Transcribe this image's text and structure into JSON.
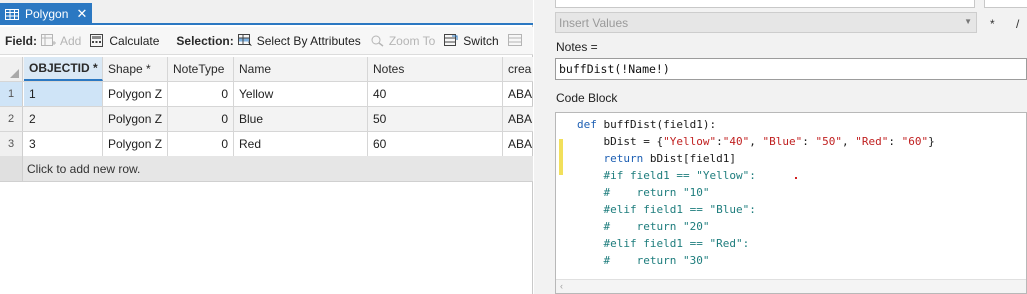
{
  "tab": {
    "title": "Polygon",
    "close": "✕"
  },
  "toolbar": {
    "field_label": "Field:",
    "add_label": "Add",
    "calculate_label": "Calculate",
    "selection_label": "Selection:",
    "select_by_attributes_label": "Select By Attributes",
    "zoom_to_label": "Zoom To",
    "switch_label": "Switch"
  },
  "table": {
    "columns": [
      "OBJECTID *",
      "Shape *",
      "NoteType",
      "Name",
      "Notes",
      "crea"
    ],
    "rows": [
      {
        "rownum": "1",
        "objectid": "1",
        "shape": "Polygon Z",
        "notetype": "0",
        "name": "Yellow",
        "notes": "40",
        "crea": "ABA"
      },
      {
        "rownum": "2",
        "objectid": "2",
        "shape": "Polygon Z",
        "notetype": "0",
        "name": "Blue",
        "notes": "50",
        "crea": "ABA"
      },
      {
        "rownum": "3",
        "objectid": "3",
        "shape": "Polygon Z",
        "notetype": "0",
        "name": "Red",
        "notes": "60",
        "crea": "ABA"
      }
    ],
    "add_row_text": "Click to add new row."
  },
  "calculator": {
    "insert_values_placeholder": "Insert Values",
    "op_multiply": "*",
    "op_divide": "/",
    "expression_label": "Notes =",
    "expression": "buffDist(!Name!)",
    "code_block_label": "Code Block",
    "code_lines": [
      "def buffDist(field1):",
      "    bDist = {\"Yellow\":\"40\", \"Blue\": \"50\", \"Red\": \"60\"}",
      "    return bDist[field1]",
      "    #if field1 == \"Yellow\":",
      "    #    return \"10\"",
      "    #elif field1 == \"Blue\":",
      "    #    return \"20\"",
      "    #elif field1 == \"Red\":",
      "    #    return \"30\""
    ]
  },
  "colors": {
    "accent": "#2b78c2",
    "selected_row": "#cfe4f7",
    "keyword": "#1d5fb3",
    "string": "#c02020",
    "comment": "#1e7d7d",
    "gutter_mark": "#f2e05b"
  },
  "icons": {
    "table_tab": "table-icon",
    "add": "add-field-icon",
    "calculate": "calculator-icon",
    "select_by_attributes": "select-by-attributes-icon",
    "zoom_to": "zoom-to-icon",
    "switch": "switch-selection-icon",
    "clear": "clear-selection-icon"
  }
}
